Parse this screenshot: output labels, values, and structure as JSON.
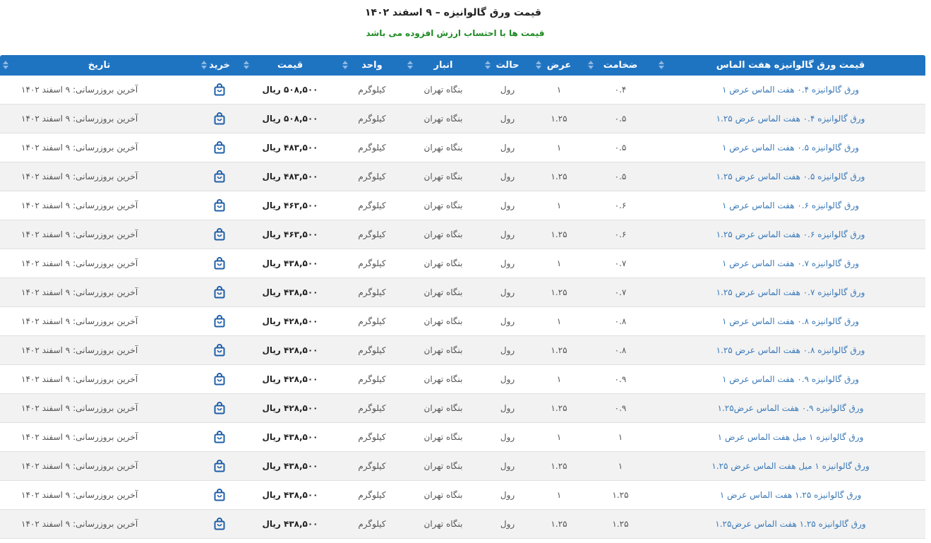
{
  "page": {
    "title": "قیمت ورق گالوانیزه – ۹ اسفند ۱۴۰۲",
    "subtitle": "قیمت ها با احتساب ارزش افزوده می باشد"
  },
  "colors": {
    "header_bg": "#1f74c2",
    "subtitle": "#1f8a24",
    "link": "#3b7ab8",
    "row_alt": "#f2f2f2",
    "cart_icon": "#1f5fa8"
  },
  "table": {
    "columns": [
      {
        "key": "name",
        "label": "قیمت ورق گالوانیزه هفت الماس",
        "sortable": true
      },
      {
        "key": "thickness",
        "label": "ضخامت",
        "sortable": true
      },
      {
        "key": "width",
        "label": "عرض",
        "sortable": true
      },
      {
        "key": "state",
        "label": "حالت",
        "sortable": true
      },
      {
        "key": "warehouse",
        "label": "انبار",
        "sortable": true
      },
      {
        "key": "unit",
        "label": "واحد",
        "sortable": true
      },
      {
        "key": "price",
        "label": "قیمت",
        "sortable": true
      },
      {
        "key": "buy",
        "label": "خرید",
        "sortable": true
      },
      {
        "key": "date",
        "label": "تاریخ",
        "sortable": true
      }
    ],
    "buy_icon": "shopping-bag-icon",
    "rows": [
      {
        "name": "ورق گالوانیزه ۰.۴ هفت الماس عرض ۱",
        "thickness": "۰.۴",
        "width": "۱",
        "state": "رول",
        "warehouse": "بنگاه تهران",
        "unit": "کیلوگرم",
        "price": "۵۰۸,۵۰۰ ریال",
        "date": "آخرین بروزرسانی: ۹ اسفند ۱۴۰۲"
      },
      {
        "name": "ورق گالوانیزه ۰.۴ هفت الماس عرض ۱.۲۵",
        "thickness": "۰.۵",
        "width": "۱.۲۵",
        "state": "رول",
        "warehouse": "بنگاه تهران",
        "unit": "کیلوگرم",
        "price": "۵۰۸,۵۰۰ ریال",
        "date": "آخرین بروزرسانی: ۹ اسفند ۱۴۰۲"
      },
      {
        "name": "ورق گالوانیزه ۰.۵ هفت الماس عرض ۱",
        "thickness": "۰.۵",
        "width": "۱",
        "state": "رول",
        "warehouse": "بنگاه تهران",
        "unit": "کیلوگرم",
        "price": "۴۸۳,۵۰۰ ریال",
        "date": "آخرین بروزرسانی: ۹ اسفند ۱۴۰۲"
      },
      {
        "name": "ورق گالوانیزه ۰.۵ هفت الماس عرض ۱.۲۵",
        "thickness": "۰.۵",
        "width": "۱.۲۵",
        "state": "رول",
        "warehouse": "بنگاه تهران",
        "unit": "کیلوگرم",
        "price": "۴۸۳,۵۰۰ ریال",
        "date": "آخرین بروزرسانی: ۹ اسفند ۱۴۰۲"
      },
      {
        "name": "ورق گالوانیزه ۰.۶ هفت الماس عرض ۱",
        "thickness": "۰.۶",
        "width": "۱",
        "state": "رول",
        "warehouse": "بنگاه تهران",
        "unit": "کیلوگرم",
        "price": "۴۶۳,۵۰۰ ریال",
        "date": "آخرین بروزرسانی: ۹ اسفند ۱۴۰۲"
      },
      {
        "name": "ورق گالوانیزه ۰.۶ هفت الماس عرض ۱.۲۵",
        "thickness": "۰.۶",
        "width": "۱.۲۵",
        "state": "رول",
        "warehouse": "بنگاه تهران",
        "unit": "کیلوگرم",
        "price": "۴۶۳,۵۰۰ ریال",
        "date": "آخرین بروزرسانی: ۹ اسفند ۱۴۰۲"
      },
      {
        "name": "ورق گالوانیزه ۰.۷ هفت الماس عرض ۱",
        "thickness": "۰.۷",
        "width": "۱",
        "state": "رول",
        "warehouse": "بنگاه تهران",
        "unit": "کیلوگرم",
        "price": "۴۳۸,۵۰۰ ریال",
        "date": "آخرین بروزرسانی: ۹ اسفند ۱۴۰۲"
      },
      {
        "name": "ورق گالوانیزه ۰.۷ هفت الماس عرض ۱.۲۵",
        "thickness": "۰.۷",
        "width": "۱.۲۵",
        "state": "رول",
        "warehouse": "بنگاه تهران",
        "unit": "کیلوگرم",
        "price": "۴۳۸,۵۰۰ ریال",
        "date": "آخرین بروزرسانی: ۹ اسفند ۱۴۰۲"
      },
      {
        "name": "ورق گالوانیزه ۰.۸ هفت الماس عرض ۱",
        "thickness": "۰.۸",
        "width": "۱",
        "state": "رول",
        "warehouse": "بنگاه تهران",
        "unit": "کیلوگرم",
        "price": "۴۲۸,۵۰۰ ریال",
        "date": "آخرین بروزرسانی: ۹ اسفند ۱۴۰۲"
      },
      {
        "name": "ورق گالوانیزه ۰.۸ هفت الماس عرض ۱.۲۵",
        "thickness": "۰.۸",
        "width": "۱.۲۵",
        "state": "رول",
        "warehouse": "بنگاه تهران",
        "unit": "کیلوگرم",
        "price": "۴۲۸,۵۰۰ ریال",
        "date": "آخرین بروزرسانی: ۹ اسفند ۱۴۰۲"
      },
      {
        "name": "ورق گالوانیزه ۰.۹ هفت الماس عرض ۱",
        "thickness": "۰.۹",
        "width": "۱",
        "state": "رول",
        "warehouse": "بنگاه تهران",
        "unit": "کیلوگرم",
        "price": "۴۲۸,۵۰۰ ریال",
        "date": "آخرین بروزرسانی: ۹ اسفند ۱۴۰۲"
      },
      {
        "name": "ورق گالوانیزه ۰.۹ هفت الماس عرض۱.۲۵",
        "thickness": "۰.۹",
        "width": "۱.۲۵",
        "state": "رول",
        "warehouse": "بنگاه تهران",
        "unit": "کیلوگرم",
        "price": "۴۲۸,۵۰۰ ریال",
        "date": "آخرین بروزرسانی: ۹ اسفند ۱۴۰۲"
      },
      {
        "name": "ورق گالوانیزه ۱ میل هفت الماس عرض ۱",
        "thickness": "۱",
        "width": "۱",
        "state": "رول",
        "warehouse": "بنگاه تهران",
        "unit": "کیلوگرم",
        "price": "۴۳۸,۵۰۰ ریال",
        "date": "آخرین بروزرسانی: ۹ اسفند ۱۴۰۲"
      },
      {
        "name": "ورق گالوانیزه ۱ میل هفت الماس عرض ۱.۲۵",
        "thickness": "۱",
        "width": "۱.۲۵",
        "state": "رول",
        "warehouse": "بنگاه تهران",
        "unit": "کیلوگرم",
        "price": "۴۳۸,۵۰۰ ریال",
        "date": "آخرین بروزرسانی: ۹ اسفند ۱۴۰۲"
      },
      {
        "name": "ورق گالوانیزه ۱.۲۵ هفت الماس عرض ۱",
        "thickness": "۱.۲۵",
        "width": "۱",
        "state": "رول",
        "warehouse": "بنگاه تهران",
        "unit": "کیلوگرم",
        "price": "۴۳۸,۵۰۰ ریال",
        "date": "آخرین بروزرسانی: ۹ اسفند ۱۴۰۲"
      },
      {
        "name": "ورق گالوانیزه ۱.۲۵ هفت الماس عرض۱.۲۵",
        "thickness": "۱.۲۵",
        "width": "۱.۲۵",
        "state": "رول",
        "warehouse": "بنگاه تهران",
        "unit": "کیلوگرم",
        "price": "۴۳۸,۵۰۰ ریال",
        "date": "آخرین بروزرسانی: ۹ اسفند ۱۴۰۲"
      }
    ]
  }
}
